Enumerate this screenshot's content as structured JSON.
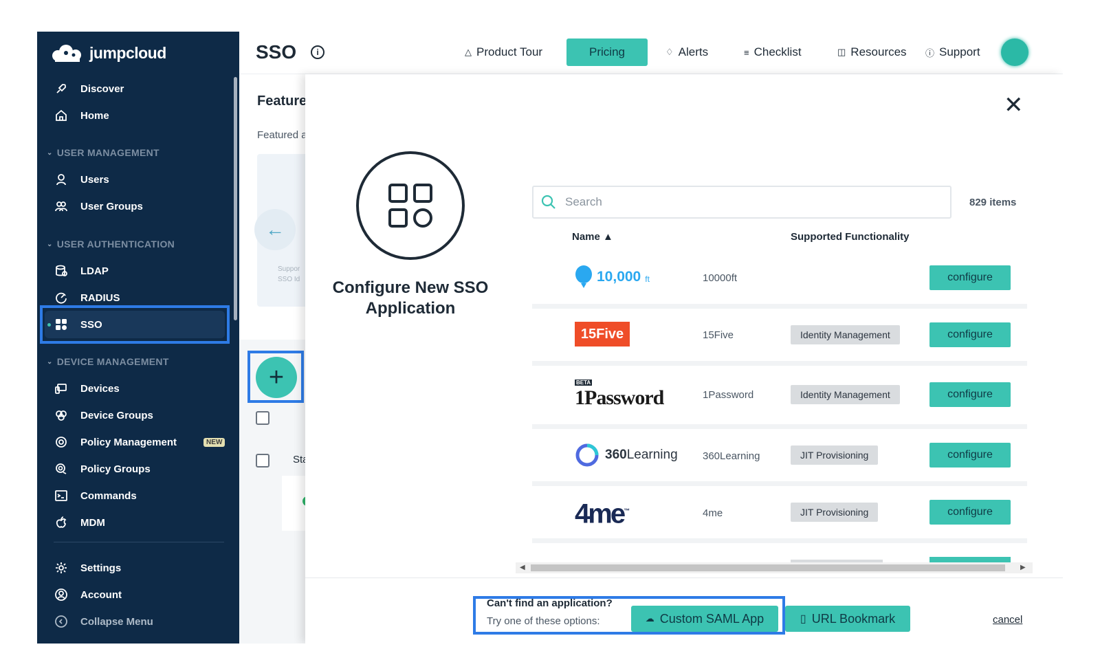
{
  "app": {
    "logo_text": "jumpcloud"
  },
  "colors": {
    "sidebar_bg": "#0e2a47",
    "accent": "#3cc3b2",
    "highlight": "#2e7be6"
  },
  "sidebar": {
    "items": [
      {
        "label": "Discover",
        "icon": "rocket-icon"
      },
      {
        "label": "Home",
        "icon": "home-icon"
      },
      {
        "label": "Users",
        "icon": "user-icon"
      },
      {
        "label": "User Groups",
        "icon": "user-groups-icon"
      },
      {
        "label": "LDAP",
        "icon": "ldap-icon"
      },
      {
        "label": "RADIUS",
        "icon": "radius-icon"
      },
      {
        "label": "SSO",
        "icon": "sso-grid-icon",
        "active": true
      },
      {
        "label": "Devices",
        "icon": "devices-icon"
      },
      {
        "label": "Device Groups",
        "icon": "device-groups-icon"
      },
      {
        "label": "Policy Management",
        "icon": "policy-icon",
        "badge": "NEW"
      },
      {
        "label": "Policy Groups",
        "icon": "policy-groups-icon"
      },
      {
        "label": "Commands",
        "icon": "terminal-icon"
      },
      {
        "label": "MDM",
        "icon": "apple-icon"
      },
      {
        "label": "Settings",
        "icon": "gear-icon"
      },
      {
        "label": "Account",
        "icon": "account-icon"
      },
      {
        "label": "Collapse Menu",
        "icon": "collapse-icon"
      }
    ],
    "sections": [
      "USER MANAGEMENT",
      "USER AUTHENTICATION",
      "DEVICE MANAGEMENT"
    ]
  },
  "header": {
    "title": "SSO",
    "links": [
      {
        "label": "Product Tour",
        "icon": "rocket-icon"
      },
      {
        "label": "Pricing"
      },
      {
        "label": "Alerts",
        "icon": "bell-icon"
      },
      {
        "label": "Checklist",
        "icon": "list-icon"
      },
      {
        "label": "Resources",
        "icon": "book-icon"
      },
      {
        "label": "Support",
        "icon": "help-icon"
      }
    ]
  },
  "underlying": {
    "featured_title": "Feature",
    "featured_sub": "Featured a",
    "card_text_1": "Suppor",
    "card_text_2": "SSO   Id",
    "status_header": "Sta"
  },
  "modal": {
    "title": "Configure New SSO Application",
    "search_placeholder": "Search",
    "items_count": "829 items",
    "columns": {
      "name": "Name ▲",
      "functionality": "Supported Functionality"
    },
    "apps": [
      {
        "logo": "10,000",
        "logo_sup": "ft",
        "name": "10000ft",
        "functionality": "",
        "action": "configure"
      },
      {
        "logo": "15Five",
        "name": "15Five",
        "functionality": "Identity Management",
        "action": "configure"
      },
      {
        "logo": "1Password",
        "logo_badge": "BETA",
        "name": "1Password",
        "functionality": "Identity Management",
        "action": "configure"
      },
      {
        "logo": "360Learning",
        "name": "360Learning",
        "functionality": "JIT Provisioning",
        "action": "configure"
      },
      {
        "logo": "4me",
        "logo_sup": "™",
        "name": "4me",
        "functionality": "JIT Provisioning",
        "action": "configure"
      }
    ],
    "footer": {
      "cant_find": "Can't find an application?",
      "try_one": "Try one of these options:",
      "custom_saml": "Custom SAML App",
      "url_bookmark": "URL Bookmark",
      "cancel": "cancel"
    }
  }
}
